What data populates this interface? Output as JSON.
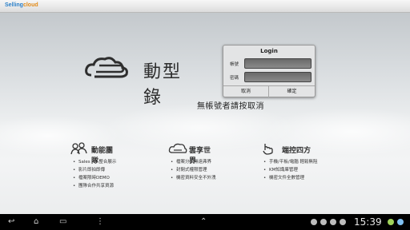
{
  "brand": {
    "part1": "Selling",
    "part2": "cloud"
  },
  "logo": {
    "text": "動型錄"
  },
  "login": {
    "title": "Login",
    "account_label": "帳號",
    "password_label": "密碼",
    "cancel_label": "取消",
    "confirm_label": "確定"
  },
  "hint": "無帳號者請按取消",
  "features": [
    {
      "title": "動能團隊",
      "items": [
        "Sales Kit 整合展示",
        "影片即拍即傳",
        "檔案限時DEMO",
        "團隊合作共享資源"
      ]
    },
    {
      "title": "雲享世界",
      "items": [
        "檔案分享無遠弗界",
        "封閉式權限管理",
        "機密資料安全不外洩"
      ]
    },
    {
      "title": "端控四方",
      "items": [
        "手機/平板/電腦 輕鬆無阻",
        "KM知識庫管理",
        "機密文件全數管理"
      ]
    }
  ],
  "statusbar": {
    "time": "15:39"
  },
  "icons": [
    "back-icon",
    "home-icon",
    "recent-apps-icon",
    "up-icon",
    "menu-icon"
  ]
}
